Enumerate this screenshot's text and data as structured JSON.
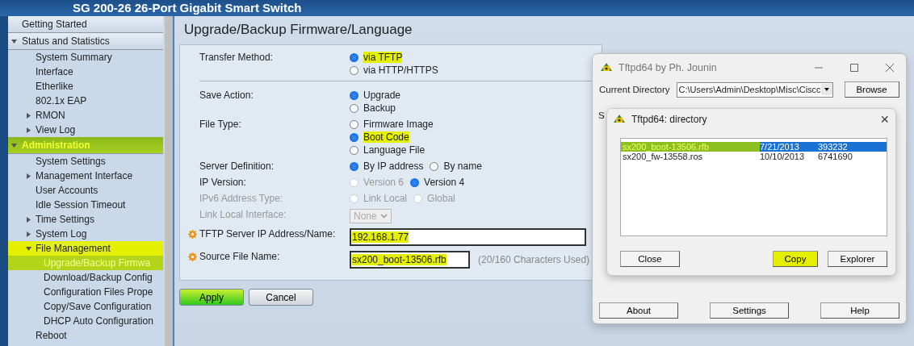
{
  "header": {
    "title": "SG 200-26 26-Port Gigabit Smart Switch"
  },
  "sidebar": {
    "items": [
      {
        "label": "Getting Started",
        "kind": "header"
      },
      {
        "label": "Status and Statistics",
        "kind": "header",
        "expanded": true,
        "children": [
          {
            "label": "System Summary"
          },
          {
            "label": "Interface"
          },
          {
            "label": "Etherlike"
          },
          {
            "label": "802.1x EAP"
          },
          {
            "label": "RMON",
            "expanded": false
          },
          {
            "label": "View Log",
            "expanded": false
          }
        ]
      },
      {
        "label": "Administration",
        "kind": "header",
        "expanded": true,
        "highlighted": true,
        "children": [
          {
            "label": "System Settings"
          },
          {
            "label": "Management Interface",
            "expanded": false
          },
          {
            "label": "User Accounts"
          },
          {
            "label": "Idle Session Timeout"
          },
          {
            "label": "Time Settings",
            "expanded": false
          },
          {
            "label": "System Log",
            "expanded": false
          },
          {
            "label": "File Management",
            "expanded": true,
            "highlighted": true,
            "children": [
              {
                "label": "Upgrade/Backup Firmwa",
                "selected": true,
                "highlighted": true
              },
              {
                "label": "Download/Backup Config",
                "selected": false
              },
              {
                "label": "Configuration Files Prope",
                "selected": false
              },
              {
                "label": "Copy/Save Configuration",
                "selected": false
              },
              {
                "label": "DHCP Auto Configuration",
                "selected": false
              }
            ]
          },
          {
            "label": "Reboot"
          }
        ]
      }
    ]
  },
  "page": {
    "title": "Upgrade/Backup Firmware/Language"
  },
  "form": {
    "rows": [
      {
        "kind": "radio-stack",
        "label": "Transfer Method:",
        "options": [
          {
            "label": "via TFTP",
            "selected": true,
            "highlighted": true
          },
          {
            "label": "via HTTP/HTTPS",
            "selected": false
          }
        ]
      },
      {
        "kind": "divider"
      },
      {
        "kind": "radio-stack",
        "label": "Save Action:",
        "options": [
          {
            "label": "Upgrade",
            "selected": true
          },
          {
            "label": "Backup",
            "selected": false
          }
        ]
      },
      {
        "kind": "radio-stack",
        "label": "File Type:",
        "options": [
          {
            "label": "Firmware Image",
            "selected": false
          },
          {
            "label": "Boot Code",
            "selected": true,
            "highlighted": true
          },
          {
            "label": "Language File",
            "selected": false
          }
        ]
      },
      {
        "kind": "radio-inline",
        "label": "Server Definition:",
        "options": [
          {
            "label": "By IP address",
            "selected": true
          },
          {
            "label": "By name",
            "selected": false
          }
        ]
      },
      {
        "kind": "radio-inline",
        "label": "IP Version:",
        "options": [
          {
            "label": "Version 6",
            "selected": false,
            "disabled": true
          },
          {
            "label": "Version 4",
            "selected": true
          }
        ]
      },
      {
        "kind": "radio-inline",
        "label": "IPv6 Address Type:",
        "disabled": true,
        "options": [
          {
            "label": "Link Local",
            "selected": false,
            "disabled": true
          },
          {
            "label": "Global",
            "selected": false,
            "disabled": true
          }
        ]
      },
      {
        "kind": "select",
        "label": "Link Local Interface:",
        "disabled": true,
        "value": "None"
      },
      {
        "kind": "text",
        "label": "TFTP Server IP Address/Name:",
        "required": true,
        "value": "192.168.1.77",
        "highlighted": true
      },
      {
        "kind": "text-counter",
        "label": "Source File Name:",
        "required": true,
        "value": "sx200_boot-13506.rfb",
        "highlighted": true,
        "hint": "(20/160 Characters Used)"
      }
    ]
  },
  "buttons": [
    {
      "label": "Apply",
      "kind": "primary",
      "highlighted": true
    },
    {
      "label": "Cancel",
      "kind": "secondary"
    }
  ],
  "tftpd": {
    "title": "Tftpd64 by Ph. Jounin",
    "directory_label": "Current Directory",
    "directory_value": "C:\\Users\\Admin\\Desktop\\Misc\\Ciscc",
    "browse": "Browse",
    "label_2": "S",
    "buttons": [
      "About",
      "Settings",
      "Help"
    ],
    "dialog": {
      "title": "Tftpd64: directory",
      "close": "×",
      "files": [
        {
          "name": "sx200_boot-13506.rfb",
          "date": "7/21/2013",
          "size": "393232",
          "selected": true,
          "highlighted": true
        },
        {
          "name": "sx200_fw-13558.ros",
          "date": "10/10/2013",
          "size": "6741690",
          "selected": false
        }
      ],
      "buttons": [
        {
          "label": "Close",
          "highlighted": false
        },
        {
          "label": "Copy",
          "highlighted": true
        },
        {
          "label": "Explorer",
          "highlighted": false
        }
      ]
    }
  }
}
